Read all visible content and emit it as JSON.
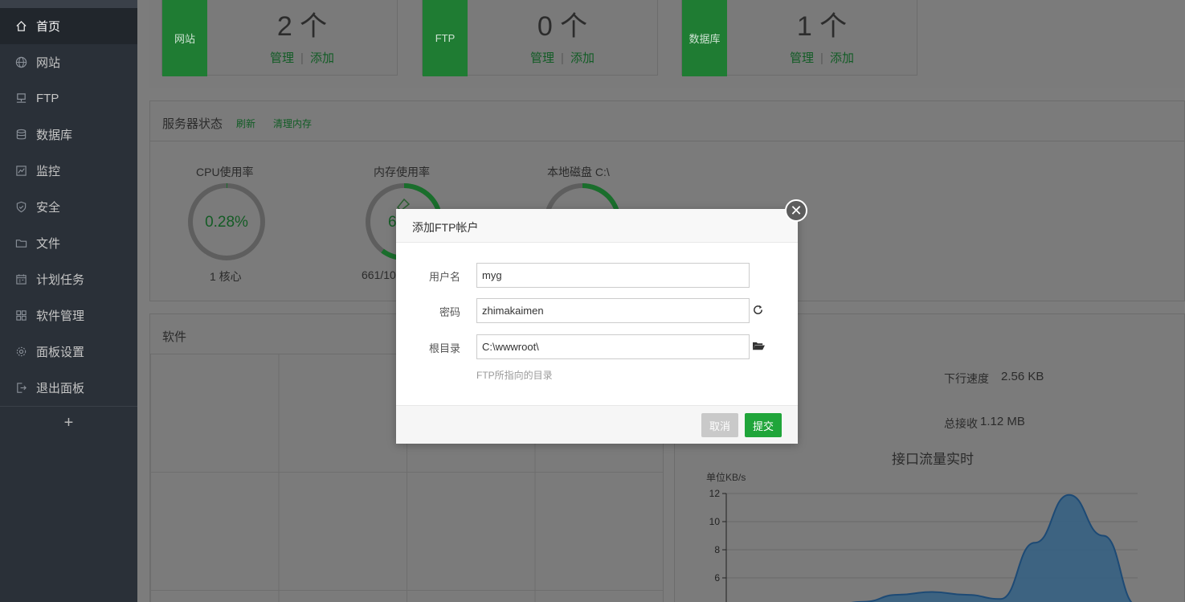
{
  "sidebar": {
    "items": [
      {
        "label": "首页",
        "icon": "home-icon"
      },
      {
        "label": "网站",
        "icon": "globe-icon"
      },
      {
        "label": "FTP",
        "icon": "ftp-icon"
      },
      {
        "label": "数据库",
        "icon": "database-icon"
      },
      {
        "label": "监控",
        "icon": "monitor-icon"
      },
      {
        "label": "安全",
        "icon": "shield-icon"
      },
      {
        "label": "文件",
        "icon": "folder-icon"
      },
      {
        "label": "计划任务",
        "icon": "calendar-icon"
      },
      {
        "label": "软件管理",
        "icon": "grid-icon"
      },
      {
        "label": "面板设置",
        "icon": "gear-icon"
      },
      {
        "label": "退出面板",
        "icon": "logout-icon"
      }
    ],
    "add_label": "+"
  },
  "cards": [
    {
      "tag": "网站",
      "count": "2 个",
      "manage": "管理",
      "sep": "|",
      "add": "添加"
    },
    {
      "tag": "FTP",
      "count": "0 个",
      "manage": "管理",
      "sep": "|",
      "add": "添加"
    },
    {
      "tag": "数据库",
      "count": "1 个",
      "manage": "管理",
      "sep": "|",
      "add": "添加"
    }
  ],
  "status": {
    "title": "服务器状态",
    "refresh": "刷新",
    "clear_memory": "清理内存",
    "cpu": {
      "label": "CPU使用率",
      "value": "0.28%",
      "sub": "1 核心",
      "percent": 0.28
    },
    "memory": {
      "label": "内存使用率",
      "value": "6",
      "sub": "661/10",
      "percent": 60
    },
    "disk": {
      "label": "本地磁盘 C:\\",
      "percent": 27
    }
  },
  "software": {
    "title": "软件"
  },
  "network": {
    "down_label": "下行速度",
    "down_value": "2.56 KB",
    "total_label": "总接收",
    "total_value": "1.12 MB",
    "chart_title": "接口流量实时",
    "unit": "单位KB/s",
    "y_ticks": [
      "12",
      "10",
      "8",
      "6"
    ]
  },
  "modal": {
    "title": "添加FTP帐户",
    "username_label": "用户名",
    "username_value": "myg",
    "password_label": "密码",
    "password_value": "zhimakaimen",
    "root_label": "根目录",
    "root_value": "C:\\wwwroot\\",
    "root_help": "FTP所指向的目录",
    "cancel": "取消",
    "submit": "提交"
  },
  "colors": {
    "accent": "#20a53a",
    "sidebar": "#2a3038"
  },
  "chart_data": {
    "type": "area",
    "title": "接口流量实时",
    "ylabel": "单位KB/s",
    "ylim": [
      4,
      12
    ],
    "y_ticks": [
      6,
      8,
      10,
      12
    ],
    "series": [
      {
        "values": [
          4,
          4,
          4,
          4,
          4.3,
          4.8,
          5,
          4.8,
          4.5,
          8.5,
          11.9,
          9,
          4
        ]
      }
    ]
  }
}
